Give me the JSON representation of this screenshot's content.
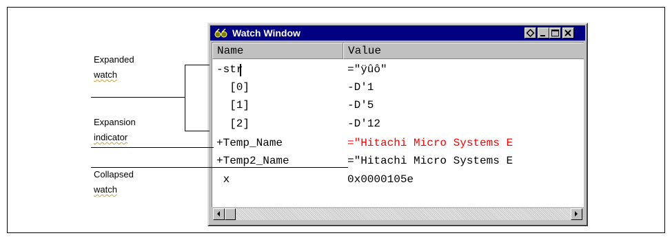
{
  "window": {
    "title": "Watch Window"
  },
  "columns": {
    "name": "Name",
    "value": "Value"
  },
  "rows": [
    {
      "name": "-str",
      "value": "=\"ÿûô\""
    },
    {
      "name": "  [0]",
      "value": "-D'1"
    },
    {
      "name": "  [1]",
      "value": "-D'5"
    },
    {
      "name": "  [2]",
      "value": "-D'12"
    },
    {
      "name": "+Temp_Name",
      "value": "=\"Hitachi Micro Systems E"
    },
    {
      "name": "+Temp2_Name",
      "value": "=\"Hitachi Micro Systems E"
    },
    {
      "name": " x",
      "value": "0x0000105e"
    }
  ],
  "callouts": {
    "expanded": {
      "line1": "Expanded",
      "line2": "watch"
    },
    "indicator": {
      "line1": "Expansion",
      "line2": "indicator"
    },
    "collapsed": {
      "line1": "Collapsed",
      "line2": "watch"
    }
  },
  "colors": {
    "titlebar": "#000080",
    "changed_value": "#ff0000",
    "chrome": "#c0c0c0"
  },
  "icons": {
    "title": "watch-glasses-icon",
    "restore": "restore-icon",
    "minimize": "minimize-icon",
    "maximize": "maximize-icon",
    "close": "close-icon",
    "scroll_left": "arrow-left-icon",
    "scroll_right": "arrow-right-icon"
  }
}
